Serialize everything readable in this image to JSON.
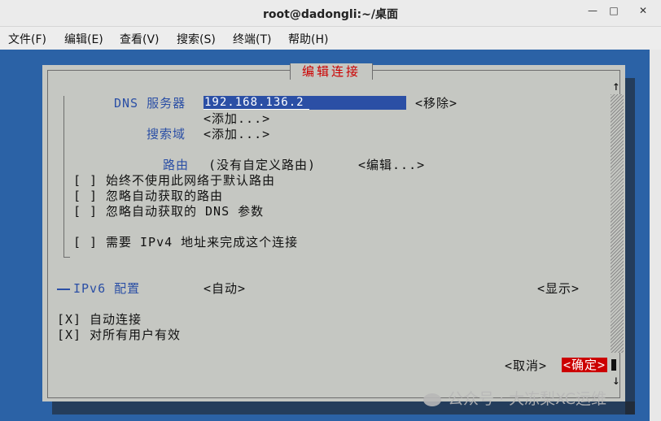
{
  "window": {
    "title": "root@dadongli:~/桌面",
    "minimize_glyph": "—",
    "maximize_glyph": "□",
    "close_glyph": "✕"
  },
  "menu": [
    "文件(F)",
    "编辑(E)",
    "查看(V)",
    "搜索(S)",
    "终端(T)",
    "帮助(H)"
  ],
  "dialog": {
    "title": "编辑连接",
    "dns_label": "DNS 服务器",
    "dns_value": "192.168.136.2",
    "remove_button": "<移除>",
    "dns_add_button": "<添加...>",
    "search_domain_label": "搜索域",
    "search_domain_add_button": "<添加...>",
    "routing_label": "路由",
    "routing_value": "(没有自定义路由)",
    "routing_edit_button": "<编辑...>",
    "checkboxes": [
      {
        "mark": "[ ]",
        "label": "始终不使用此网络于默认路由"
      },
      {
        "mark": "[ ]",
        "label": "忽略自动获取的路由"
      },
      {
        "mark": "[ ]",
        "label": "忽略自动获取的 DNS 参数"
      },
      {
        "mark": "[ ]",
        "label": "需要 IPv4 地址来完成这个连接"
      }
    ],
    "ipv6_label": "IPv6 配置",
    "ipv6_value": "<自动>",
    "ipv6_show_button": "<显示>",
    "options": [
      {
        "mark": "[X]",
        "label": "自动连接"
      },
      {
        "mark": "[X]",
        "label": "对所有用户有效"
      }
    ],
    "cancel_button": "<取消>",
    "ok_button": "<确定>",
    "scroll_up": "↑",
    "scroll_down": "↓"
  },
  "watermark": "公众号 · 大冻梨XC运维"
}
